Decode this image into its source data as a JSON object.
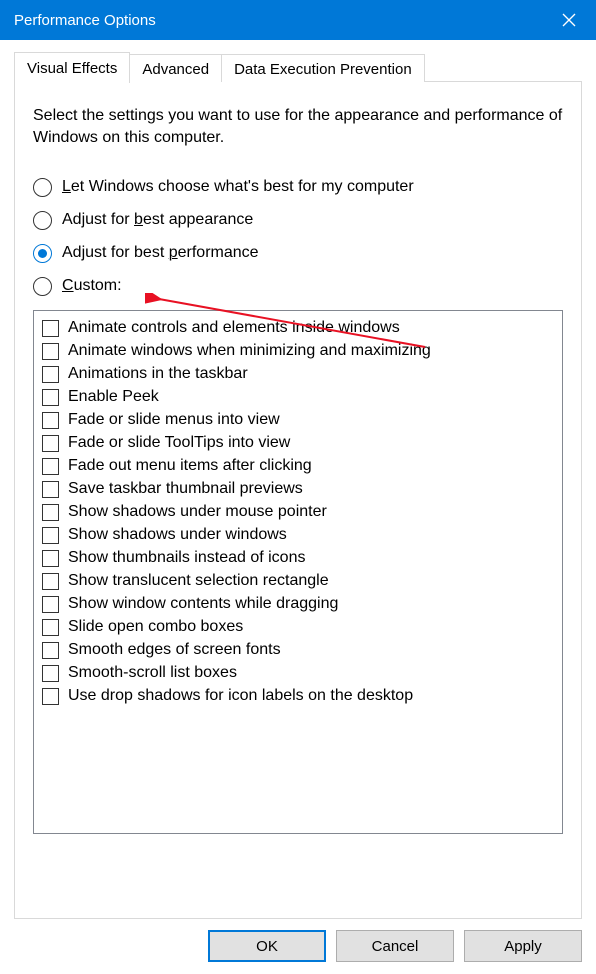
{
  "window": {
    "title": "Performance Options"
  },
  "tabs": {
    "items": [
      {
        "label": "Visual Effects",
        "active": true
      },
      {
        "label": "Advanced",
        "active": false
      },
      {
        "label": "Data Execution Prevention",
        "active": false
      }
    ]
  },
  "intro": "Select the settings you want to use for the appearance and performance of Windows on this computer.",
  "radios": [
    {
      "id": "auto",
      "pre": "",
      "acc": "L",
      "post": "et Windows choose what's best for my computer",
      "selected": false
    },
    {
      "id": "best-appearance",
      "pre": "Adjust for ",
      "acc": "b",
      "post": "est appearance",
      "selected": false
    },
    {
      "id": "best-performance",
      "pre": "Adjust for best ",
      "acc": "p",
      "post": "erformance",
      "selected": true
    },
    {
      "id": "custom",
      "pre": "",
      "acc": "C",
      "post": "ustom:",
      "selected": false
    }
  ],
  "checks": [
    "Animate controls and elements inside windows",
    "Animate windows when minimizing and maximizing",
    "Animations in the taskbar",
    "Enable Peek",
    "Fade or slide menus into view",
    "Fade or slide ToolTips into view",
    "Fade out menu items after clicking",
    "Save taskbar thumbnail previews",
    "Show shadows under mouse pointer",
    "Show shadows under windows",
    "Show thumbnails instead of icons",
    "Show translucent selection rectangle",
    "Show window contents while dragging",
    "Slide open combo boxes",
    "Smooth edges of screen fonts",
    "Smooth-scroll list boxes",
    "Use drop shadows for icon labels on the desktop"
  ],
  "buttons": {
    "ok": "OK",
    "cancel": "Cancel",
    "apply": "Apply"
  }
}
